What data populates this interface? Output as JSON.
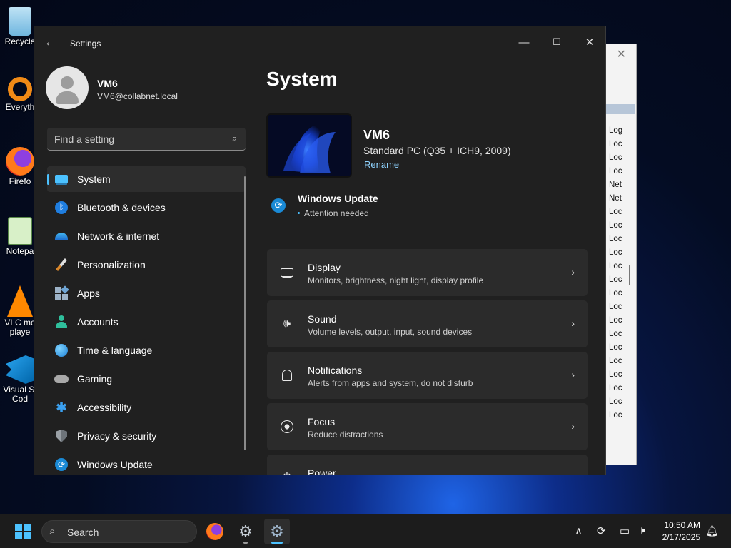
{
  "desktop": {
    "icons": [
      {
        "label": "Recycle",
        "icon": "recycle-bin-icon"
      },
      {
        "label": "Everyth",
        "icon": "everything-search-icon"
      },
      {
        "label": "Firefo",
        "icon": "firefox-icon"
      },
      {
        "label": "Notepa",
        "icon": "notepad-icon"
      },
      {
        "label": "VLC me",
        "label2": "playe",
        "icon": "vlc-icon"
      },
      {
        "label": "Visual St",
        "label2": "Cod",
        "icon": "vscode-icon"
      }
    ]
  },
  "bg_window": {
    "rows": [
      "Log",
      "Loc",
      "Loc",
      "Loc",
      "Net",
      "Net",
      "Loc",
      "Loc",
      "Loc",
      "Loc",
      "Loc",
      "Loc",
      "Loc",
      "Loc",
      "Loc",
      "Loc",
      "Loc",
      "Loc",
      "Loc",
      "Loc",
      "Loc",
      "Loc"
    ]
  },
  "window": {
    "title": "Settings",
    "controls": {
      "minimize": "—",
      "maximize": "☐",
      "close": "✕"
    }
  },
  "user": {
    "name": "VM6",
    "email": "VM6@collabnet.local"
  },
  "search": {
    "placeholder": "Find a setting"
  },
  "nav": [
    {
      "label": "System",
      "icon": "system-icon",
      "selected": true
    },
    {
      "label": "Bluetooth & devices",
      "icon": "bluetooth-icon"
    },
    {
      "label": "Network & internet",
      "icon": "wifi-icon"
    },
    {
      "label": "Personalization",
      "icon": "brush-icon"
    },
    {
      "label": "Apps",
      "icon": "apps-icon"
    },
    {
      "label": "Accounts",
      "icon": "person-icon"
    },
    {
      "label": "Time & language",
      "icon": "globe-clock-icon"
    },
    {
      "label": "Gaming",
      "icon": "gamepad-icon"
    },
    {
      "label": "Accessibility",
      "icon": "accessibility-icon"
    },
    {
      "label": "Privacy & security",
      "icon": "shield-icon"
    },
    {
      "label": "Windows Update",
      "icon": "windows-update-icon"
    }
  ],
  "main": {
    "title": "System",
    "device": {
      "name": "VM6",
      "model": "Standard PC (Q35 + ICH9, 2009)",
      "rename": "Rename"
    },
    "update": {
      "title": "Windows Update",
      "status": "Attention needed"
    },
    "cards": [
      {
        "title": "Display",
        "subtitle": "Monitors, brightness, night light, display profile",
        "icon": "monitor-icon"
      },
      {
        "title": "Sound",
        "subtitle": "Volume levels, output, input, sound devices",
        "icon": "speaker-icon"
      },
      {
        "title": "Notifications",
        "subtitle": "Alerts from apps and system, do not disturb",
        "icon": "bell-icon"
      },
      {
        "title": "Focus",
        "subtitle": "Reduce distractions",
        "icon": "focus-icon"
      },
      {
        "title": "Power",
        "subtitle": "",
        "icon": "power-icon"
      }
    ]
  },
  "taskbar": {
    "search": "Search",
    "time": "10:50 AM",
    "date": "2/17/2025"
  },
  "colors": {
    "accent": "#4cc2ff",
    "window_bg": "#202020",
    "card_bg": "#2b2b2b"
  }
}
